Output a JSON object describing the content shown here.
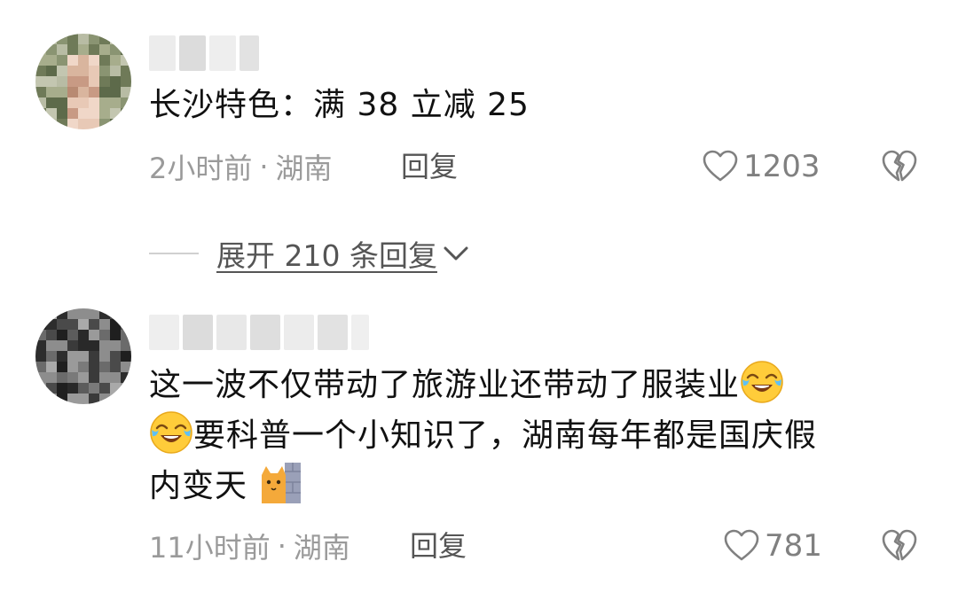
{
  "comments": [
    {
      "username_redacted": true,
      "text": "长沙特色：满 38 立减 25",
      "time": "2小时前",
      "separator": "·",
      "location": "湖南",
      "reply_label": "回复",
      "likes": "1203",
      "icons": {
        "like": "heart-outline-icon",
        "dislike": "broken-heart-icon"
      }
    },
    {
      "username_redacted": true,
      "text_part1": "这一波不仅带动了旅游业还带动了服装业",
      "text_part2": "要科普一个小知识了，湖南每年都是国庆假",
      "text_part3": "内变天",
      "emojis": [
        "crying-laughing-emoji",
        "crying-laughing-emoji",
        "cat-peeking-wall-emoji"
      ],
      "time": "11小时前",
      "separator": "·",
      "location": "湖南",
      "reply_label": "回复",
      "likes": "781",
      "icons": {
        "like": "heart-outline-icon",
        "dislike": "broken-heart-icon"
      }
    }
  ],
  "expand_replies": {
    "label": "展开 210 条回复",
    "icon": "chevron-down-icon"
  },
  "colors": {
    "text_primary": "#111111",
    "text_meta": "#9a9a9a",
    "text_secondary": "#555555",
    "like_gray": "#808080"
  }
}
